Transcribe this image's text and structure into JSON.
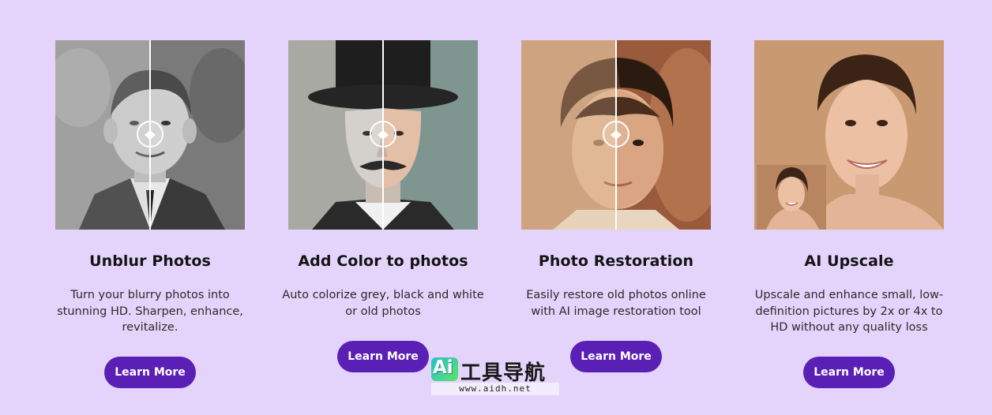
{
  "cards": [
    {
      "title": "Unblur Photos",
      "description": "Turn your blurry photos into stunning HD. Sharpen, enhance, revitalize.",
      "button_label": "Learn More",
      "image": "before-after-unblur-photo",
      "slider_icon": "compare-slider-handle-icon"
    },
    {
      "title": "Add Color to photos",
      "description": "Auto colorize grey, black and white or old photos",
      "button_label": "Learn More",
      "image": "before-after-colorize-photo",
      "slider_icon": "compare-slider-handle-icon"
    },
    {
      "title": "Photo Restoration",
      "description": "Easily restore old photos online with AI image restoration tool",
      "button_label": "Learn More",
      "image": "before-after-restoration-photo",
      "slider_icon": "compare-slider-handle-icon"
    },
    {
      "title": "AI Upscale",
      "description": "Upscale and enhance small, low-definition pictures by 2x or 4x to HD without any quality loss",
      "button_label": "Learn More",
      "image": "upscale-portrait-photo"
    }
  ],
  "watermark": {
    "badge": "Ai",
    "name": "工具导航",
    "url": "www.aidh.net"
  },
  "colors": {
    "background": "#e4d4fb",
    "button": "#5a1fb5",
    "button_text": "#ffffff"
  }
}
